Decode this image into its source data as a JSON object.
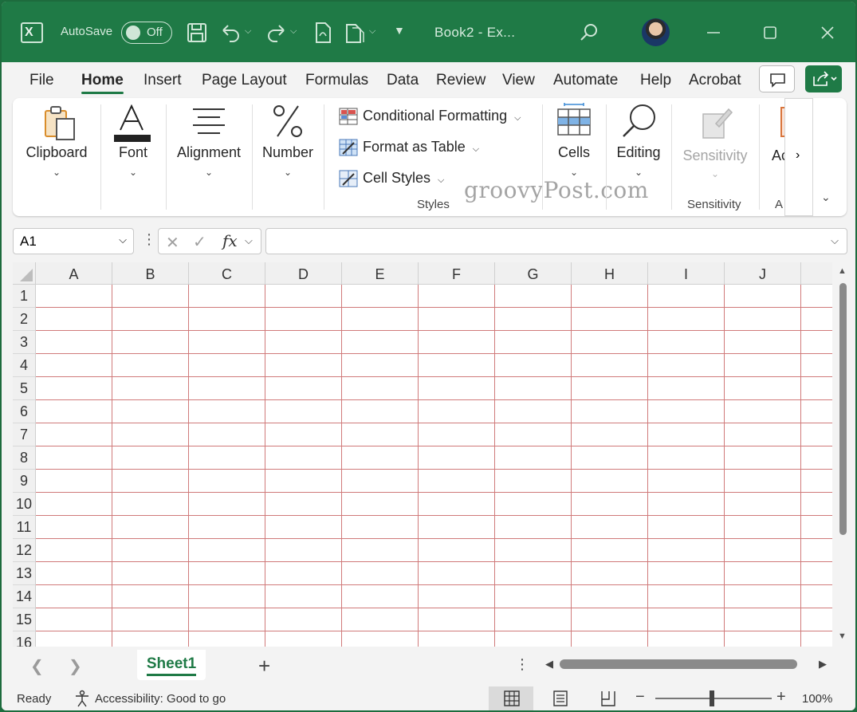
{
  "titlebar": {
    "autosave_label": "AutoSave",
    "autosave_state": "Off",
    "doc_title": "Book2  -  Ex..."
  },
  "menu": {
    "items": [
      "File",
      "Home",
      "Insert",
      "Page Layout",
      "Formulas",
      "Data",
      "Review",
      "View",
      "Automate",
      "Help",
      "Acrobat"
    ],
    "active": "Home"
  },
  "ribbon": {
    "clipboard": "Clipboard",
    "font": "Font",
    "alignment": "Alignment",
    "number": "Number",
    "conditional_formatting": "Conditional Formatting",
    "format_as_table": "Format as Table",
    "cell_styles": "Cell Styles",
    "styles_caption": "Styles",
    "cells": "Cells",
    "editing": "Editing",
    "sensitivity": "Sensitivity",
    "sensitivity_caption": "Sensitivity",
    "addins_partial": "Ac",
    "addins_caption_partial": "A",
    "watermark": "groovyPost.com"
  },
  "formula_bar": {
    "name_box": "A1",
    "fx": "fx",
    "value": ""
  },
  "grid": {
    "columns": [
      "A",
      "B",
      "C",
      "D",
      "E",
      "F",
      "G",
      "H",
      "I",
      "J"
    ],
    "rows": [
      "1",
      "2",
      "3",
      "4",
      "5",
      "6",
      "7",
      "8",
      "9",
      "10",
      "11",
      "12",
      "13",
      "14",
      "15",
      "16"
    ]
  },
  "sheets": {
    "tabs": [
      "Sheet1"
    ],
    "active": "Sheet1"
  },
  "status": {
    "ready": "Ready",
    "accessibility": "Accessibility: Good to go",
    "zoom": "100%",
    "zoom_level_percent": 100
  },
  "colors": {
    "brand_green": "#1f7a46",
    "gridline": "#d07a7a"
  }
}
